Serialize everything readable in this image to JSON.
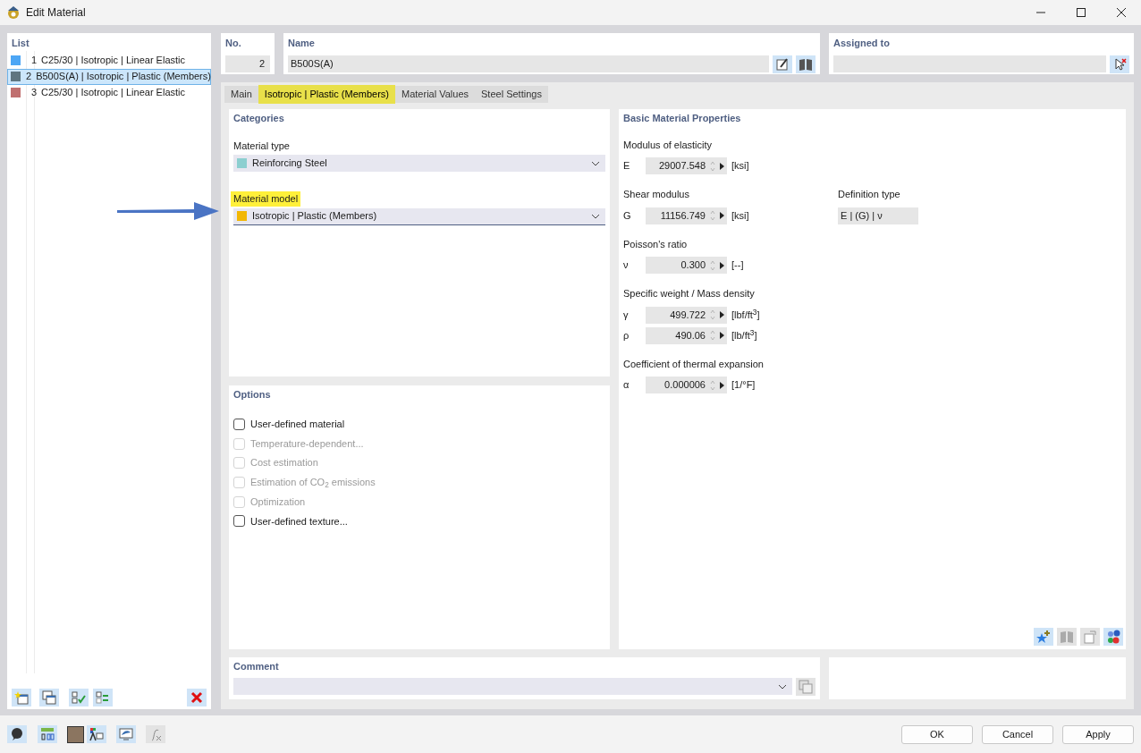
{
  "window": {
    "title": "Edit Material"
  },
  "list": {
    "title": "List",
    "items": [
      {
        "number": "1",
        "label": "C25/30 | Isotropic | Linear Elastic",
        "color": "#4da6f5",
        "selected": false
      },
      {
        "number": "2",
        "label": "B500S(A) | Isotropic | Plastic (Members)",
        "color": "#5f7580",
        "selected": true
      },
      {
        "number": "3",
        "label": "C25/30 | Isotropic | Linear Elastic",
        "color": "#c07070",
        "selected": false
      }
    ]
  },
  "number": {
    "label": "No.",
    "value": "2"
  },
  "name": {
    "label": "Name",
    "value": "B500S(A)"
  },
  "assigned_to": {
    "label": "Assigned to"
  },
  "tabs": [
    {
      "label": "Main",
      "selected": false,
      "highlighted": false
    },
    {
      "label": "Isotropic | Plastic (Members)",
      "selected": true,
      "highlighted": true
    },
    {
      "label": "Material Values",
      "selected": false,
      "highlighted": false
    },
    {
      "label": "Steel Settings",
      "selected": false,
      "highlighted": false
    }
  ],
  "categories": {
    "title": "Categories",
    "fields": [
      {
        "label": "Material type",
        "value": "Reinforcing Steel",
        "color": "#8ccfd0",
        "highlighted": false
      },
      {
        "label": "Material model",
        "value": "Isotropic | Plastic (Members)",
        "color": "#f2b705",
        "highlighted": true
      }
    ]
  },
  "options": {
    "title": "Options",
    "items": [
      {
        "label": "User-defined material",
        "checked": false,
        "disabled": false
      },
      {
        "label": "Temperature-dependent...",
        "checked": false,
        "disabled": true
      },
      {
        "label": "Cost estimation",
        "checked": false,
        "disabled": true
      },
      {
        "label": "Estimation of CO$_{2}$ emissions",
        "checked": false,
        "disabled": true
      },
      {
        "label": "Optimization",
        "checked": false,
        "disabled": true
      },
      {
        "label": "User-defined texture...",
        "checked": false,
        "disabled": false
      }
    ]
  },
  "properties": {
    "title": "Basic Material Properties",
    "groups": [
      {
        "label": "Modulus of elasticity",
        "rows": [
          {
            "symbol": "E",
            "value": "29007.548",
            "unit": "[ksi]"
          }
        ]
      },
      {
        "label": "Shear modulus",
        "rows": [
          {
            "symbol": "G",
            "value": "11156.749",
            "unit": "[ksi]"
          }
        ],
        "aside": {
          "label": "Definition type",
          "value": "E | (G) | ν"
        }
      },
      {
        "label": "Poisson's ratio",
        "rows": [
          {
            "symbol": "ν",
            "value": "0.300",
            "unit": "[--]"
          }
        ]
      },
      {
        "label": "Specific weight / Mass density",
        "rows": [
          {
            "symbol": "γ",
            "value": "499.722",
            "unit": "[lbf/ft$^{3}$]"
          },
          {
            "symbol": "ρ",
            "value": "490.06",
            "unit": "[lb/ft$^{3}$]"
          }
        ]
      },
      {
        "label": "Coefficient of thermal expansion",
        "rows": [
          {
            "symbol": "α",
            "value": "0.000006",
            "unit": "[1/°F]"
          }
        ]
      }
    ]
  },
  "comment": {
    "title": "Comment"
  },
  "buttons": [
    "OK",
    "Cancel",
    "Apply"
  ]
}
